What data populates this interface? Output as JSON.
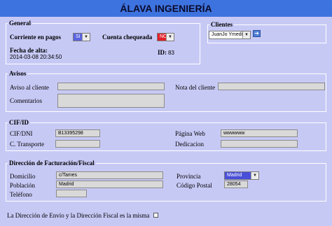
{
  "header": {
    "title": "ÁLAVA INGENIERÍA"
  },
  "general": {
    "legend": "General",
    "corriente_label": "Corriente en pagos",
    "corriente_value": "SI",
    "cuenta_label": "Cuenta chequeada",
    "cuenta_value": "NO",
    "fecha_label": "Fecha de alta:",
    "fecha_value": "2014-03-08 20:34:50",
    "id_label": "ID:",
    "id_value": "83"
  },
  "clientes": {
    "legend": "Clientes",
    "selected": "JuanJo Ymedio"
  },
  "avisos": {
    "legend": "Avisos",
    "aviso_label": "Aviso al cliente",
    "aviso_value": "",
    "nota_label": "Nota del cliente",
    "nota_value": "",
    "comentarios_label": "Comentarios"
  },
  "cifid": {
    "legend": "CIF/ID",
    "cif_label": "CIF/DNI",
    "cif_value": "B13395298",
    "web_label": "Página Web",
    "web_value": "wwwwww",
    "transporte_label": "C. Transporte",
    "transporte_value": "",
    "dedicacion_label": "Dedicacion",
    "dedicacion_value": ""
  },
  "direccion": {
    "legend": "Dirección de Facturación/Fiscal",
    "domicilio_label": "Domicilio",
    "domicilio_value": "c/Tames",
    "provincia_label": "Provincia",
    "provincia_value": "Madrid",
    "poblacion_label": "Población",
    "poblacion_value": "Madrid",
    "cp_label": "Código Postal",
    "cp_value": "28054",
    "telefono_label": "Teléfono",
    "telefono_value": ""
  },
  "footer": {
    "same_address_label": "La Dirección de Envío y la Dirección Fiscal es la misma"
  },
  "colors": {
    "header": "#3d73df",
    "background": "#c7c9f5",
    "yes_select": "#5a63e0",
    "no_select": "#e0202a",
    "provincia_select": "#4a4fd8"
  }
}
